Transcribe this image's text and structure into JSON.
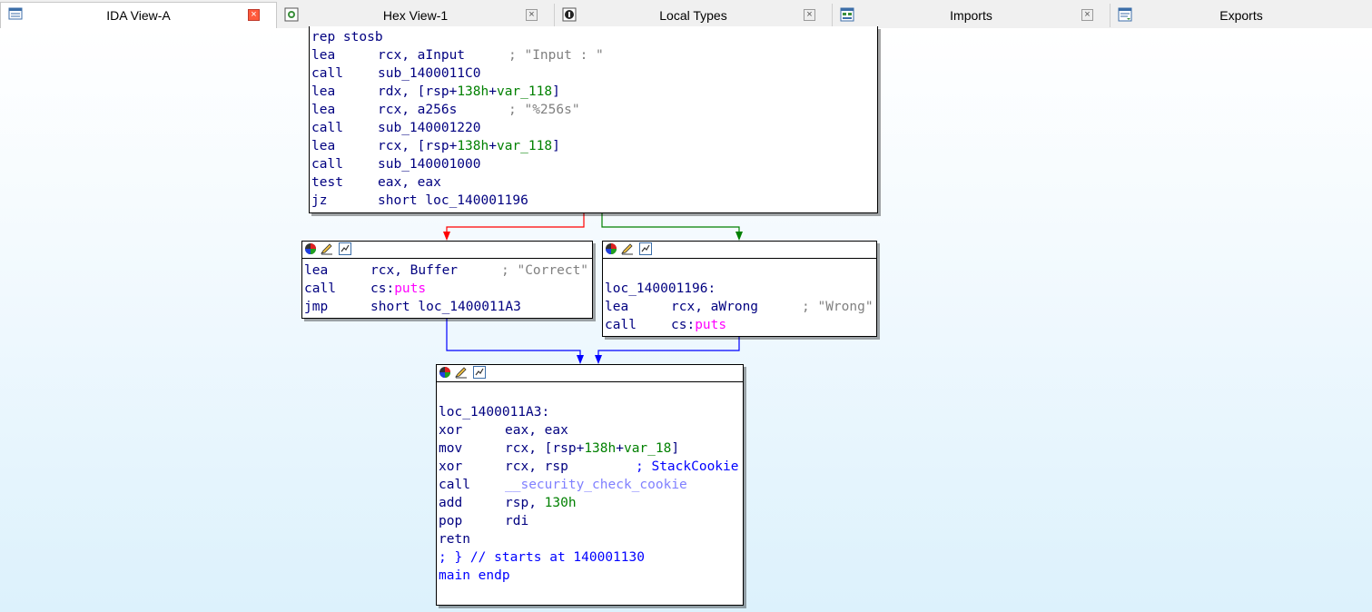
{
  "tabs": [
    {
      "label": "IDA View-A",
      "icon": "ida-view-icon",
      "active": true
    },
    {
      "label": "Hex View-1",
      "icon": "hex-view-icon",
      "active": false
    },
    {
      "label": "Local Types",
      "icon": "local-types-icon",
      "active": false
    },
    {
      "label": "Imports",
      "icon": "imports-icon",
      "active": false
    },
    {
      "label": "Exports",
      "icon": "exports-icon",
      "active": false
    }
  ],
  "colors": {
    "edge_false": "#ff0000",
    "edge_true": "#008000",
    "edge_uncond": "#0000ff",
    "code_text": "#000080",
    "comment": "#808080",
    "number": "#008000",
    "import": "#ff00ff"
  },
  "block_top": {
    "lines": [
      {
        "mn": "rep stosb",
        "op": "",
        "cm": ""
      },
      {
        "mn": "lea",
        "op": "rcx, aInput",
        "cm": "; \"Input : \""
      },
      {
        "mn": "call",
        "op": "sub_1400011C0",
        "cm": ""
      },
      {
        "mn": "lea",
        "op_pre": "rdx, [rsp+",
        "op_num": "138h",
        "op_mid": "+",
        "op_var": "var_118",
        "op_post": "]",
        "cm": ""
      },
      {
        "mn": "lea",
        "op": "rcx, a256s",
        "cm": "; \"%256s\""
      },
      {
        "mn": "call",
        "op": "sub_140001220",
        "cm": ""
      },
      {
        "mn": "lea",
        "op_pre": "rcx, [rsp+",
        "op_num": "138h",
        "op_mid": "+",
        "op_var": "var_118",
        "op_post": "]",
        "cm": ""
      },
      {
        "mn": "call",
        "op": "sub_140001000",
        "cm": ""
      },
      {
        "mn": "test",
        "op": "eax, eax",
        "cm": ""
      },
      {
        "mn": "jz",
        "op": "short loc_140001196",
        "cm": ""
      }
    ]
  },
  "block_correct": {
    "lines": [
      {
        "mn": "lea",
        "op": "rcx, Buffer",
        "cm": "; \"Correct\""
      },
      {
        "mn": "call",
        "op_pre": "cs:",
        "op_imp": "puts",
        "cm": ""
      },
      {
        "mn": "jmp",
        "op": "short loc_1400011A3",
        "cm": ""
      }
    ]
  },
  "block_wrong": {
    "label": "loc_140001196:",
    "lines": [
      {
        "mn": "lea",
        "op": "rcx, aWrong",
        "cm": "; \"Wrong\""
      },
      {
        "mn": "call",
        "op_pre": "cs:",
        "op_imp": "puts",
        "cm": ""
      }
    ]
  },
  "block_end": {
    "label": "loc_1400011A3:",
    "lines": [
      {
        "mn": "xor",
        "op": "eax, eax",
        "cm": ""
      },
      {
        "mn": "mov",
        "op_pre": "rcx, [rsp+",
        "op_num": "138h",
        "op_mid": "+",
        "op_var": "var_18",
        "op_post": "]",
        "cm": ""
      },
      {
        "mn": "xor",
        "op": "rcx, rsp",
        "cm": "; StackCookie"
      },
      {
        "mn": "call",
        "op": "__security_check_cookie",
        "cm": ""
      },
      {
        "mn": "add",
        "op_pre": "rsp, ",
        "op_num": "130h",
        "cm": ""
      },
      {
        "mn": "pop",
        "op": "rdi",
        "cm": ""
      },
      {
        "mn": "retn",
        "op": "",
        "cm": ""
      }
    ],
    "footer1": "; } // starts at 140001130",
    "footer2": "main endp"
  }
}
